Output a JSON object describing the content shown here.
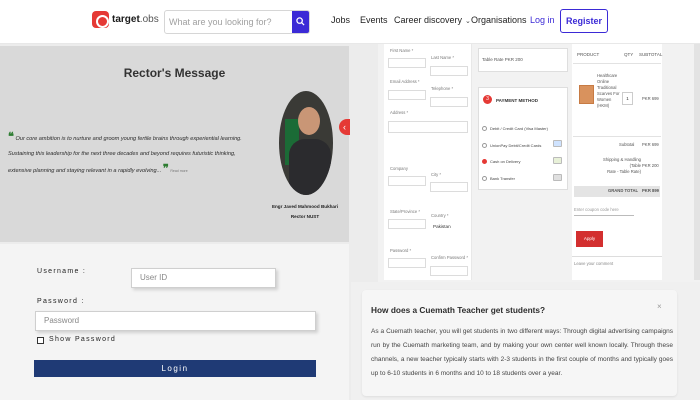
{
  "header": {
    "logo_main": "target",
    "logo_suffix": ".obs",
    "search_placeholder": "What are you looking for?",
    "nav": [
      "Jobs",
      "Events",
      "Career discovery",
      "Organisations"
    ],
    "login": "Log in",
    "register": "Register",
    "accent_color": "#3b2ad6"
  },
  "rector": {
    "title": "Rector's Message",
    "quote_lines": [
      "Our core ambition is to nurture and groom young fertile brains through experiential learning.",
      "Sustaining this leadership for the next three decades and beyond requires futuristic thinking,",
      "extensive planning and staying relevant in a rapidly evolving..."
    ],
    "quote_more": "Read more",
    "name": "Engr Javed Mahmood Bukhari",
    "role": "Rector NUST",
    "arrow": "‹"
  },
  "login": {
    "username_label": "Username :",
    "username_placeholder": "User ID",
    "password_label": "Password :",
    "password_placeholder": "Password",
    "show_password": "Show Password",
    "button": "Login",
    "button_color": "#1f3a75"
  },
  "checkout": {
    "form": {
      "first_name": "First Name *",
      "last_name": "Last Name *",
      "email": "Email Address *",
      "telephone": "Telephone *",
      "address": "Address *",
      "company": "Company",
      "city": "City *",
      "state": "State/Province *",
      "country_label": "Country *",
      "country_value": "Pakistan",
      "password": "Password *",
      "confirm_password": "Confirm Password *"
    },
    "table_rate": "Table Rate PKR 200",
    "payment": {
      "step": "3",
      "title": "PAYMENT METHOD",
      "options": [
        "Debit / Credit Card (Visa Master)",
        "UnionPay Debit/Credit Cards",
        "Cash on Delivery",
        "Bank Transfer"
      ]
    },
    "cart": {
      "headers": [
        "PRODUCT",
        "QTY",
        "SUBTOTAL"
      ],
      "product_lines": [
        "Healthcare",
        "Online",
        "Traditional",
        "Scarves For",
        "Women",
        "(HKM)"
      ],
      "qty": "1",
      "price": "PKR 699",
      "subtotal_label": "Subtotal",
      "subtotal_value": "PKR 699",
      "shipping_label_lines": [
        "Shipping & Handling (Table",
        "Rate - Table Rate)"
      ],
      "shipping_value": "PKR 200",
      "grand_label": "GRAND TOTAL",
      "grand_value": "PKR 899",
      "coupon_placeholder": "Enter coupon code here",
      "apply": "Apply",
      "comment_placeholder": "Leave your comment"
    }
  },
  "faq": {
    "question": "How does a Cuemath Teacher get students?",
    "close": "×",
    "answer": "As a Cuemath teacher, you will get students in two different ways: Through digital advertising campaigns run by the Cuemath marketing team, and by making your own center well known locally. Through these channels, a new teacher typically starts with 2-3 students in the first couple of months and typically goes up to 6-10 students in 6 months and 10 to 18 students over a year."
  }
}
